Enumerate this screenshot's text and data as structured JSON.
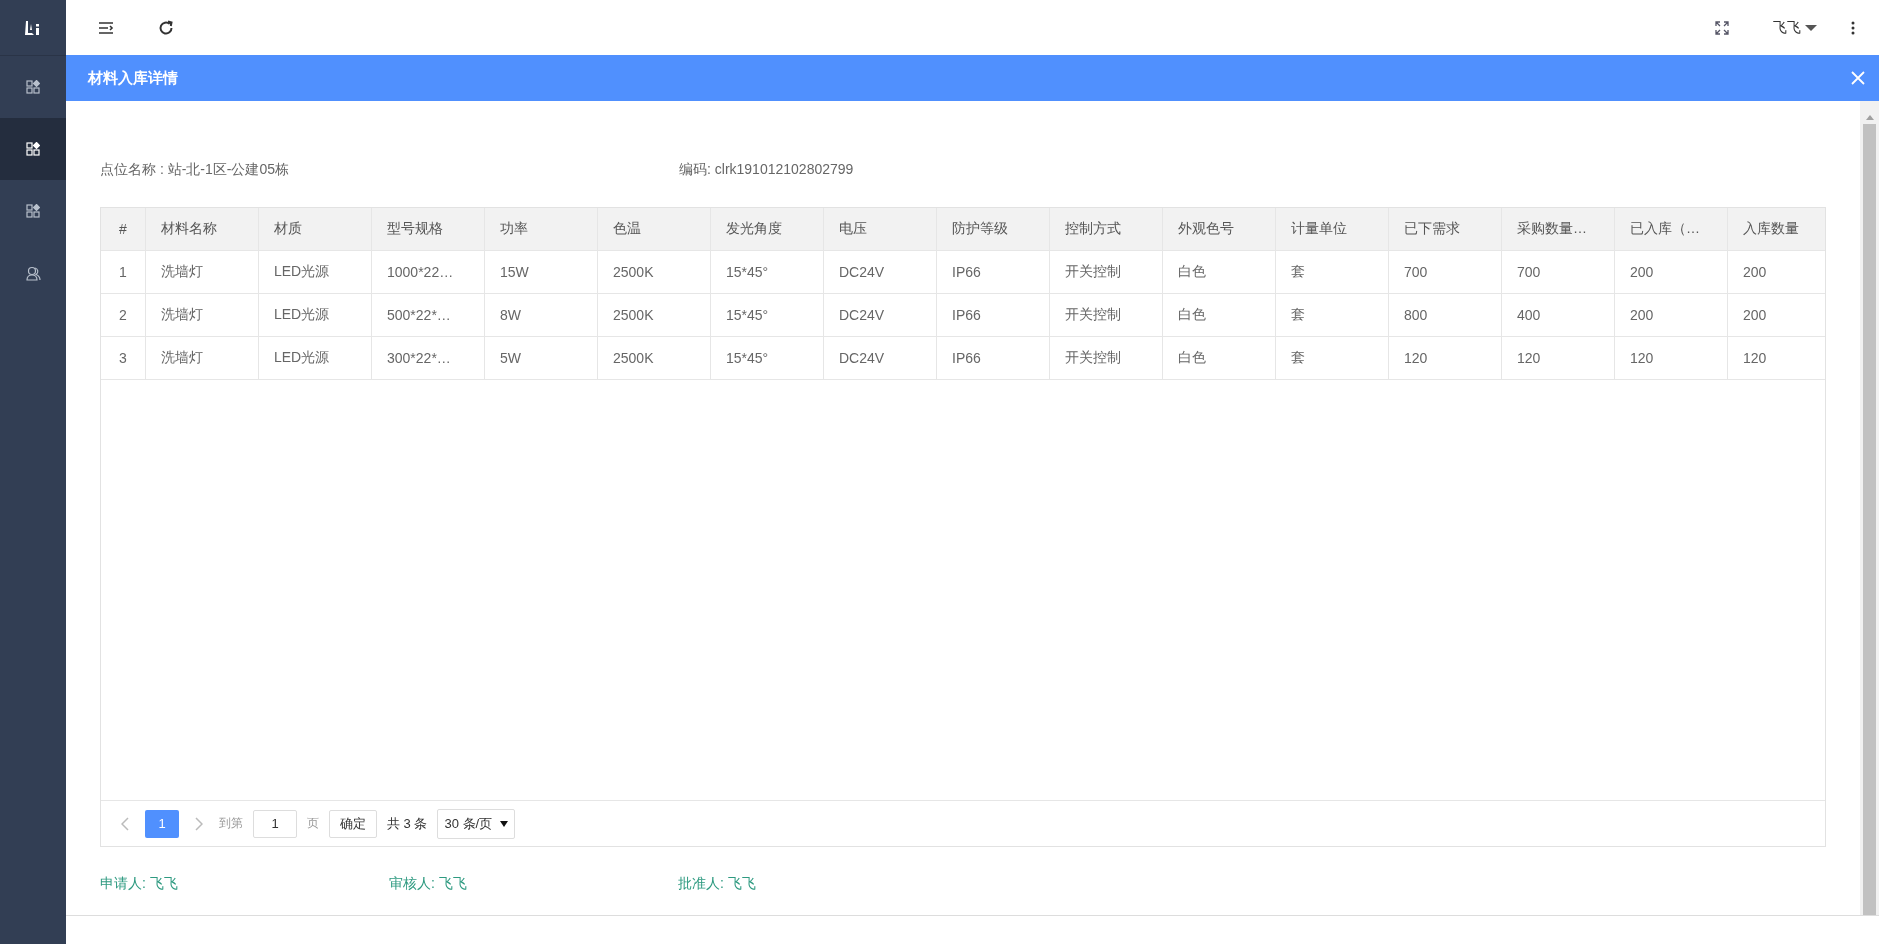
{
  "sidebar": {
    "items": [
      {
        "kind": "apps",
        "selected": false
      },
      {
        "kind": "apps",
        "selected": true
      },
      {
        "kind": "apps",
        "selected": false
      },
      {
        "kind": "user",
        "selected": false
      }
    ]
  },
  "topbar": {
    "user": "飞飞"
  },
  "panel": {
    "title": "材料入库详情"
  },
  "info": {
    "location": "点位名称 : 站-北-1区-公建05栋",
    "code": "编码: clrk191012102802799"
  },
  "table": {
    "columns": [
      "#",
      "材料名称",
      "材质",
      "型号规格",
      "功率",
      "色温",
      "发光角度",
      "电压",
      "防护等级",
      "控制方式",
      "外观色号",
      "计量单位",
      "已下需求",
      "采购数量…",
      "已入库（…",
      "入库数量"
    ],
    "rows": [
      [
        "1",
        "洗墙灯",
        "LED光源",
        "1000*22…",
        "15W",
        "2500K",
        "15*45°",
        "DC24V",
        "IP66",
        "开关控制",
        "白色",
        "套",
        "700",
        "700",
        "200",
        "200"
      ],
      [
        "2",
        "洗墙灯",
        "LED光源",
        "500*22*…",
        "8W",
        "2500K",
        "15*45°",
        "DC24V",
        "IP66",
        "开关控制",
        "白色",
        "套",
        "800",
        "400",
        "200",
        "200"
      ],
      [
        "3",
        "洗墙灯",
        "LED光源",
        "300*22*…",
        "5W",
        "2500K",
        "15*45°",
        "DC24V",
        "IP66",
        "开关控制",
        "白色",
        "套",
        "120",
        "120",
        "120",
        "120"
      ]
    ]
  },
  "pagination": {
    "pages": [
      {
        "label": "1",
        "selected": true
      }
    ],
    "goto_label": "到第",
    "goto_value": "1",
    "page_unit": "页",
    "confirm": "确定",
    "total": "共 3 条",
    "page_size": "30 条/页"
  },
  "signatures": [
    "申请人: 飞飞",
    "审核人: 飞飞",
    "批准人: 飞飞"
  ]
}
